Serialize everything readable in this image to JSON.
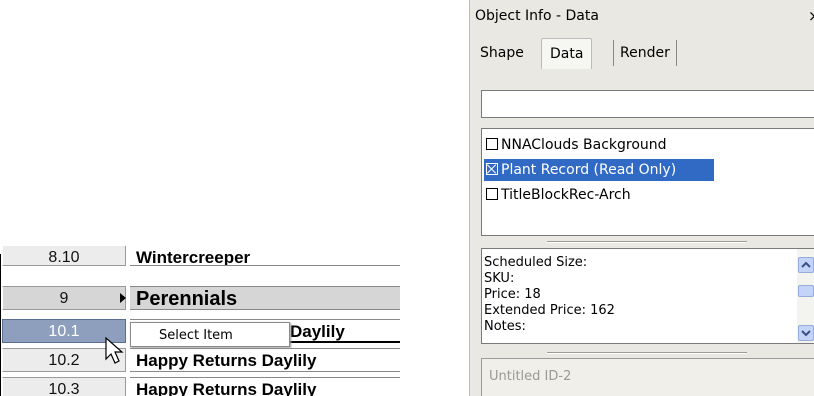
{
  "worksheet": {
    "rows": [
      {
        "number": "8.10",
        "name": "Wintercreeper"
      },
      {
        "number": "9",
        "name": "Perennials"
      },
      {
        "number": "10.1",
        "name": "Daylily"
      },
      {
        "number": "10.2",
        "name": "Happy Returns Daylily"
      },
      {
        "number": "10.3",
        "name": "Happy Returns Daylily"
      }
    ],
    "context_menu": {
      "item": "Select Item"
    }
  },
  "palette": {
    "title": "Object Info - Data",
    "close_glyph": "×",
    "tabs": {
      "shape": "Shape",
      "data": "Data",
      "render": "Render"
    },
    "search_value": "",
    "records": [
      {
        "label": "NNAClouds Background",
        "checked": false
      },
      {
        "label": "Plant Record (Read Only)",
        "checked": true
      },
      {
        "label": "TitleBlockRec-Arch",
        "checked": false
      }
    ],
    "info_lines": [
      "Scheduled Size:",
      "SKU:",
      "Price: 18",
      "Extended Price: 162",
      "Notes:"
    ],
    "object_name_placeholder": "Untitled ID-2"
  },
  "colors": {
    "selection": "#316ac5",
    "selected_row": "#8e9fbe",
    "palette_bg": "#e9e8e2"
  }
}
